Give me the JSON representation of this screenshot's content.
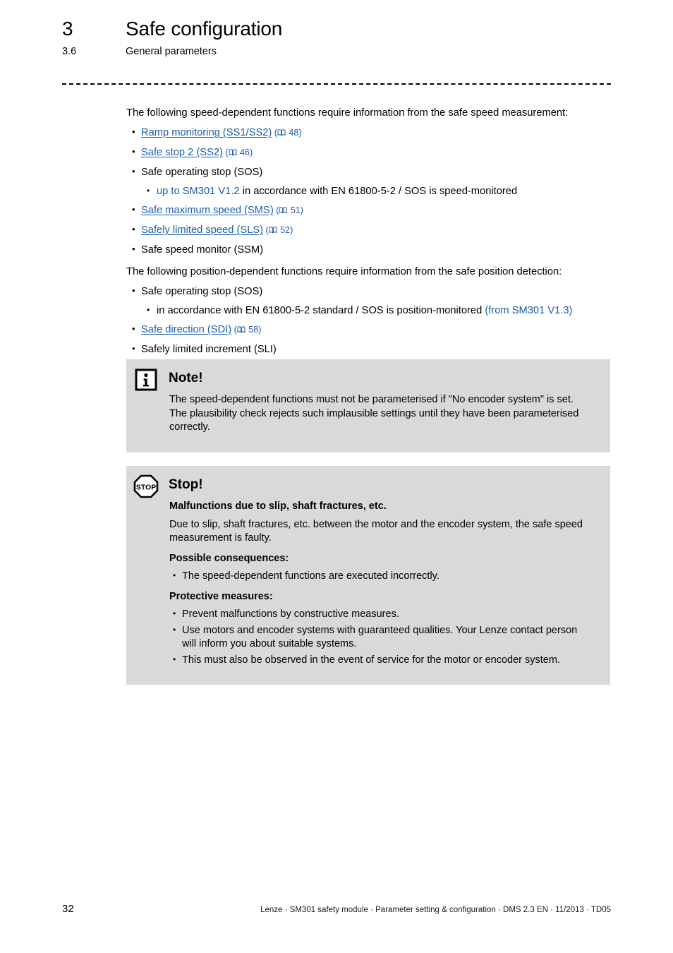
{
  "header": {
    "chapter_number": "3",
    "chapter_title": "Safe configuration",
    "section_number": "3.6",
    "section_title": "General parameters"
  },
  "colors": {
    "link": "#1a5cab",
    "callout_background": "#d9d9d9",
    "text": "#000000"
  },
  "body": {
    "intro_speed": "The following speed-dependent functions require information from the safe speed measurement:",
    "speed_items": [
      {
        "label": "Ramp monitoring (SS1/SS2)",
        "link": true,
        "page": "48"
      },
      {
        "label": "Safe stop 2 (SS2)",
        "link": true,
        "page": "46"
      },
      {
        "label": "Safe operating stop (SOS)",
        "link": false,
        "page": "",
        "sub": [
          {
            "version": "up to SM301 V1.2",
            "version_position": "before",
            "text": "in accordance with EN 61800-5-2 / SOS is speed-monitored"
          }
        ]
      },
      {
        "label": "Safe maximum speed (SMS)",
        "link": true,
        "page": "51"
      },
      {
        "label": "Safely limited speed (SLS)",
        "link": true,
        "page": "52"
      },
      {
        "label": "Safe speed monitor (SSM)",
        "link": false,
        "page": ""
      }
    ],
    "intro_position": "The following position-dependent functions require information from the safe position detection:",
    "position_items": [
      {
        "label": "Safe operating stop (SOS)",
        "link": false,
        "page": "",
        "sub": [
          {
            "version": "(from SM301 V1.3)",
            "version_position": "after",
            "text": "in accordance with EN 61800-5-2 standard / SOS is position-monitored"
          }
        ]
      },
      {
        "label": "Safe direction (SDI)",
        "link": true,
        "page": "58"
      },
      {
        "label": "Safely limited increment (SLI)",
        "link": false,
        "page": ""
      }
    ]
  },
  "note_box": {
    "icon": "info-icon",
    "title": "Note!",
    "paragraphs": [
      "The speed-dependent functions must not be parameterised if \"No encoder system\" is set. The plausibility check rejects such implausible settings until they have been parameterised correctly."
    ]
  },
  "stop_box": {
    "icon": "stop-icon",
    "icon_label": "STOP",
    "title": "Stop!",
    "subtitle": "Malfunctions due to slip, shaft fractures, etc.",
    "description": "Due to slip, shaft fractures, etc. between the motor and the encoder system, the safe speed measurement is faulty.",
    "consequences_heading": "Possible consequences:",
    "consequences": [
      "The speed-dependent functions are executed incorrectly."
    ],
    "measures_heading": "Protective measures:",
    "measures": [
      "Prevent malfunctions by constructive measures.",
      "Use motors and encoder systems with guaranteed qualities. Your Lenze contact person will inform you about suitable systems.",
      "This must also be observed in the event of service for the motor or encoder system."
    ]
  },
  "footer": {
    "page_number": "32",
    "text": "Lenze · SM301 safety module · Parameter setting & configuration · DMS 2.3 EN · 11/2013 · TD05"
  }
}
